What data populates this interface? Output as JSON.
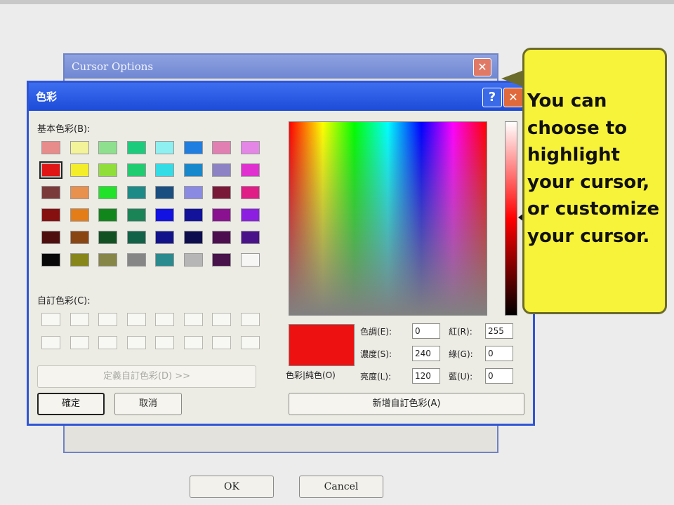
{
  "background_dialog": {
    "title": "Cursor Options",
    "close_glyph": "✕",
    "ok_label": "OK",
    "cancel_label": "Cancel"
  },
  "color_dialog": {
    "title": "色彩",
    "help_glyph": "?",
    "close_glyph": "✕",
    "basic_colors_label": "基本色彩(B):",
    "custom_colors_label": "自訂色彩(C):",
    "define_custom_label": "定義自訂色彩(D) >>",
    "ok_label": "確定",
    "cancel_label": "取消",
    "add_custom_label": "新增自訂色彩(A)",
    "color_solid_label": "色彩|純色(O)",
    "hue_label": "色調(E):",
    "hue_value": "0",
    "sat_label": "濃度(S):",
    "sat_value": "240",
    "lum_label": "亮度(L):",
    "lum_value": "120",
    "red_label": "紅(R):",
    "red_value": "255",
    "green_label": "綠(G):",
    "green_value": "0",
    "blue_label": "藍(U):",
    "blue_value": "0",
    "preview_color": "#ee1111",
    "basic_colors": [
      [
        "#e88b8b",
        "#f3f39a",
        "#8ee08e",
        "#1ccc7c",
        "#8ef0f0",
        "#1f7ee0",
        "#e27fb2",
        "#e486e6"
      ],
      [
        "#e01515",
        "#f4ee2a",
        "#90de3a",
        "#20cc70",
        "#34dce6",
        "#1888cc",
        "#8c82c4",
        "#e030d0"
      ],
      [
        "#7a3a3a",
        "#e8904e",
        "#22e22a",
        "#1c8a86",
        "#1a4e80",
        "#8a8ae2",
        "#7a1838",
        "#e01c86"
      ],
      [
        "#861010",
        "#e47d18",
        "#11861a",
        "#1a8456",
        "#1212e2",
        "#12129a",
        "#8a1290",
        "#8c1ee2"
      ],
      [
        "#4e0e0e",
        "#8a4612",
        "#125222",
        "#126248",
        "#12128a",
        "#0e0e4e",
        "#4c0e4e",
        "#4a1288"
      ],
      [
        "#080808",
        "#86861a",
        "#868648",
        "#868686",
        "#2a8a8e",
        "#b6b6b6",
        "#48124a",
        "#f6f6f4"
      ]
    ]
  },
  "callout": {
    "text": "You can choose to highlight your cursor, or customize your cursor."
  }
}
